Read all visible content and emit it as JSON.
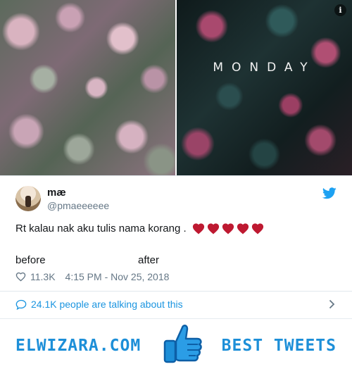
{
  "tweet": {
    "photos": {
      "overlay_text": "MONDAY",
      "info_button": "i"
    },
    "author": {
      "name": "mæ",
      "handle": "@pmaeeeeee"
    },
    "text": "Rt kalau nak aku tulis nama korang .",
    "emoji": [
      "heart",
      "heart",
      "heart",
      "heart",
      "heart"
    ],
    "captions": {
      "before": "before",
      "after": "after"
    },
    "likes": "11.3K",
    "timestamp": "4:15 PM - Nov 25, 2018",
    "talking": "24.1K people are talking about this"
  },
  "footer": {
    "brand": "ELWIZARA.COM",
    "tagline": "BEST TWEETS"
  },
  "colors": {
    "twitter_blue": "#1da1f2",
    "link_blue": "#1b95e0",
    "heart_red": "#be1931",
    "muted": "#657786",
    "footer_blue": "#1d8fd8"
  }
}
